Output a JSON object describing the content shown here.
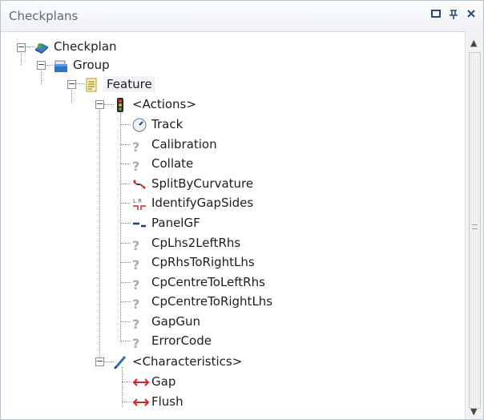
{
  "panel": {
    "title": "Checkplans",
    "buttons": [
      {
        "name": "restore-window-button",
        "glyph": "□"
      },
      {
        "name": "pin-button",
        "glyph": "ꟼ"
      },
      {
        "name": "close-button",
        "glyph": "✕"
      }
    ]
  },
  "tree": {
    "root": {
      "label": "Checkplan",
      "icon": "checkplan-icon"
    },
    "group": {
      "label": "Group",
      "icon": "group-icon"
    },
    "feature": {
      "label": "Feature",
      "icon": "feature-icon"
    },
    "actions": {
      "label": "<Actions>",
      "icon": "traffic-light-icon",
      "items": [
        {
          "label": "Track",
          "icon": "track-gauge-icon"
        },
        {
          "label": "Calibration",
          "icon": "question-icon"
        },
        {
          "label": "Collate",
          "icon": "question-icon"
        },
        {
          "label": "SplitByCurvature",
          "icon": "split-curvature-icon"
        },
        {
          "label": "IdentifyGapSides",
          "icon": "gap-sides-icon"
        },
        {
          "label": "PanelGF",
          "icon": "panel-gf-icon"
        },
        {
          "label": "CpLhs2LeftRhs",
          "icon": "question-icon"
        },
        {
          "label": "CpRhsToRightLhs",
          "icon": "question-icon"
        },
        {
          "label": "CpCentreToLeftRhs",
          "icon": "question-icon"
        },
        {
          "label": "CpCentreToRightLhs",
          "icon": "question-icon"
        },
        {
          "label": "GapGun",
          "icon": "question-icon"
        },
        {
          "label": "ErrorCode",
          "icon": "question-icon"
        }
      ]
    },
    "characteristics": {
      "label": "<Characteristics>",
      "icon": "pen-icon",
      "items": [
        {
          "label": "Gap",
          "icon": "double-arrow-icon"
        },
        {
          "label": "Flush",
          "icon": "double-arrow-icon"
        }
      ]
    }
  },
  "colors": {
    "arrow_red": "#d8232a",
    "panel_blue": "#1e3f7a"
  }
}
